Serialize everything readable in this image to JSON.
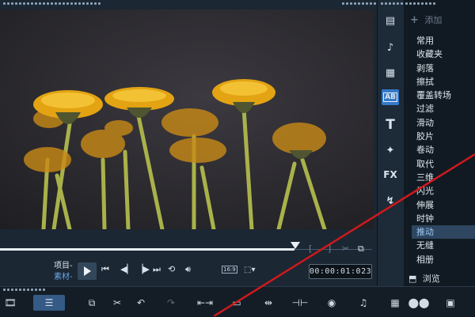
{
  "preview": {
    "mode_project": "项目-",
    "mode_clip": "素材-",
    "timecode": "00:00:01:023",
    "aspect_ratio": "16:9",
    "play_icon": "play-icon"
  },
  "library": {
    "add_label": "添加",
    "categories": [
      "常用",
      "收藏夹",
      "剥落",
      "擦拭",
      "覆盖转场",
      "过滤",
      "滑动",
      "胶片",
      "卷动",
      "取代",
      "三维",
      "闪光",
      "伸展",
      "时钟",
      "推动",
      "无缝",
      "相册"
    ],
    "selected": "推动",
    "browse_label": "浏览"
  },
  "side_tabs": [
    "media-icon",
    "music-icon",
    "instant-project-icon",
    "transition-icon",
    "title-icon",
    "graphic-icon",
    "filter-icon",
    "path-icon"
  ],
  "colors": {
    "accent": "#3579c7",
    "selected_bg": "#2e4660",
    "annotation_line": "#d0191c"
  }
}
